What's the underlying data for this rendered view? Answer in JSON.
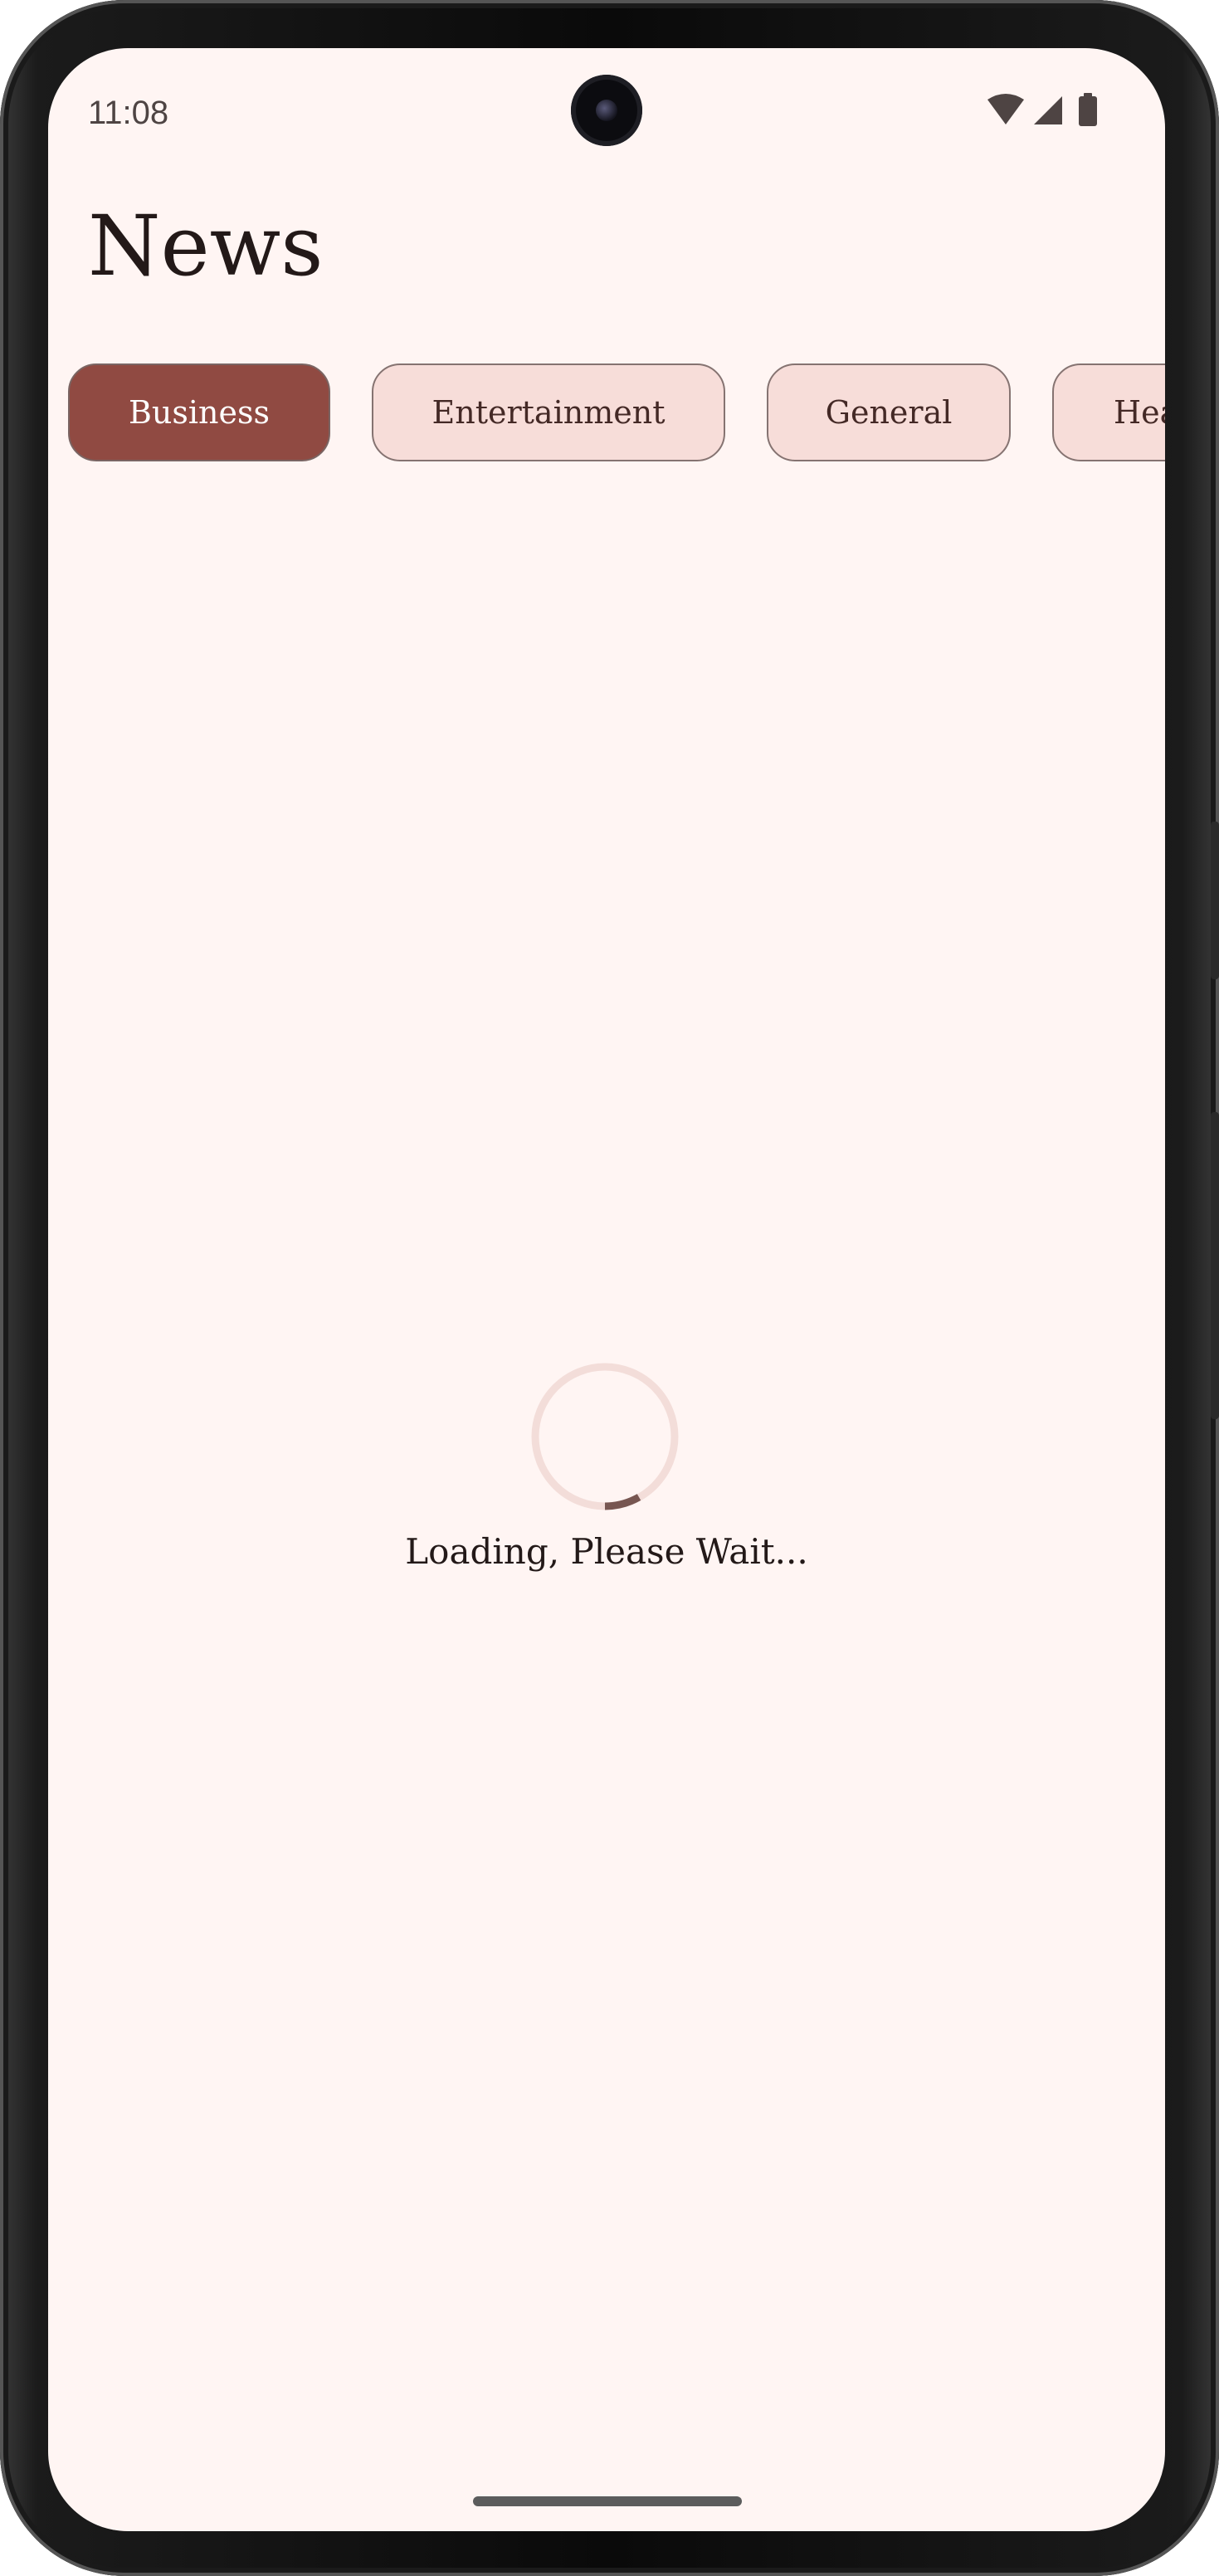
{
  "status_bar": {
    "time": "11:08",
    "icons": [
      "wifi-icon",
      "cellular-signal-icon",
      "battery-icon"
    ]
  },
  "header": {
    "title": "News"
  },
  "categories": {
    "selected": "Business",
    "chips": [
      {
        "label": "Business",
        "selected": true
      },
      {
        "label": "Entertainment",
        "selected": false
      },
      {
        "label": "General",
        "selected": false
      },
      {
        "label": "Health",
        "selected": false
      }
    ]
  },
  "loading": {
    "message": "Loading, Please Wait..."
  },
  "colors": {
    "background": "#fff5f3",
    "selected_chip": "#904a42",
    "chip": "#f7ddd9",
    "spinner_track": "#f3ddd9",
    "spinner_arc": "#775651"
  }
}
